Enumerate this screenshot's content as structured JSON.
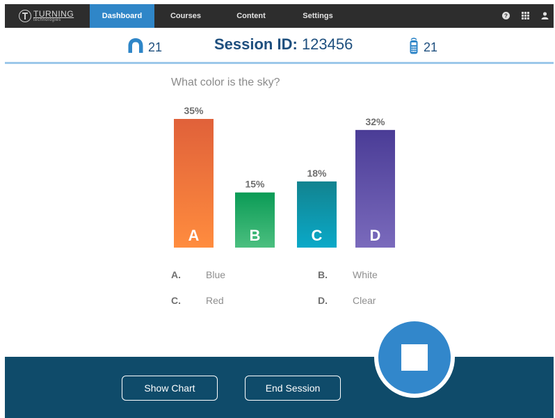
{
  "nav": {
    "logo_main": "TURNING",
    "logo_sub": "technologies",
    "tabs": [
      {
        "label": "Dashboard",
        "active": true
      },
      {
        "label": "Courses",
        "active": false
      },
      {
        "label": "Content",
        "active": false
      },
      {
        "label": "Settings",
        "active": false
      }
    ],
    "icons": [
      "help-icon",
      "grid-icon",
      "user-icon"
    ]
  },
  "session": {
    "participants": "21",
    "id_label": "Session ID:",
    "id_value": "123456",
    "devices": "21"
  },
  "question": "What color is the sky?",
  "chart_data": {
    "type": "bar",
    "categories": [
      "A",
      "B",
      "C",
      "D"
    ],
    "values": [
      35,
      15,
      18,
      32
    ],
    "value_labels": [
      "35%",
      "15%",
      "18%",
      "32%"
    ],
    "colors": [
      [
        "#e0613a",
        "#ff8c3e"
      ],
      [
        "#0b9b56",
        "#4bbf7f"
      ],
      [
        "#12838f",
        "#0aa9c8"
      ],
      [
        "#4a3c96",
        "#7a6abc"
      ]
    ],
    "ylim": [
      0,
      35
    ]
  },
  "answers": [
    {
      "letter": "A.",
      "text": "Blue"
    },
    {
      "letter": "B.",
      "text": "White"
    },
    {
      "letter": "C.",
      "text": "Red"
    },
    {
      "letter": "D.",
      "text": "Clear"
    }
  ],
  "buttons": {
    "show_chart": "Show Chart",
    "end_session": "End Session"
  },
  "colors": {
    "accent": "#2f86c8",
    "navy": "#0f4b6a",
    "text_dark": "#1e4f7e"
  }
}
